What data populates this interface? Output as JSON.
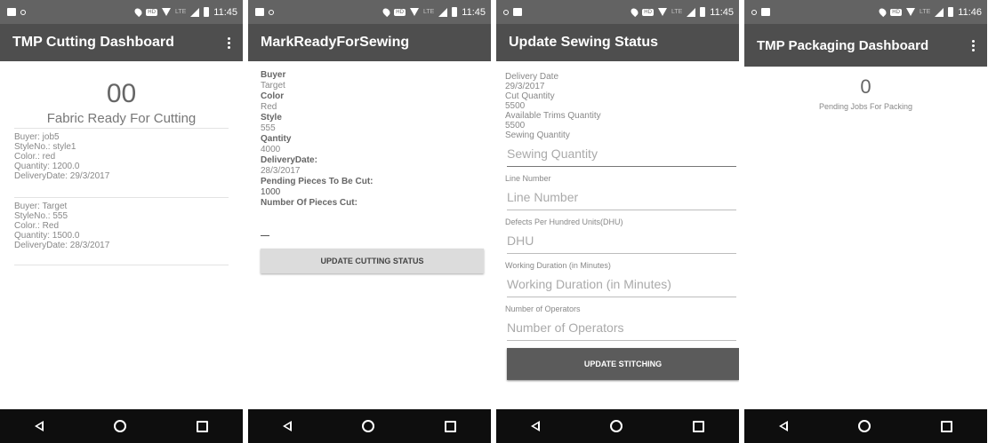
{
  "status_bar": {
    "time": "11:45",
    "time_last": "11:46"
  },
  "screens": {
    "cutting": {
      "title": "TMP Cutting Dashboard",
      "count": "00",
      "count_label": "Fabric Ready For Cutting",
      "jobs": [
        {
          "buyer": "Buyer: job5",
          "style": "StyleNo.: style1",
          "color": "Color.: red",
          "quantity": "Quantity: 1200.0",
          "delivery": "DeliveryDate: 29/3/2017"
        },
        {
          "buyer": "Buyer: Target",
          "style": "StyleNo.: 555",
          "color": "Color.: Red",
          "quantity": "Quantity: 1500.0",
          "delivery": "DeliveryDate: 28/3/2017"
        }
      ]
    },
    "mark_ready": {
      "title": "MarkReadyForSewing",
      "buyer_label": "Buyer",
      "buyer": "Target",
      "color_label": "Color",
      "color": "Red",
      "style_label": "Style",
      "style": "555",
      "qty_label": "Qantity",
      "qty": "4000",
      "delivery_label": "DeliveryDate:",
      "delivery": "28/3/2017",
      "pending_label": "Pending Pieces To Be Cut:",
      "pending": "1000",
      "cut_label": "Number Of Pieces Cut:",
      "button": "UPDATE CUTTING STATUS"
    },
    "sewing": {
      "title": "Update Sewing Status",
      "delivery_label": "Delivery Date",
      "delivery": "29/3/2017",
      "cut_label": "Cut Quantity",
      "cut": "5500",
      "trims_label": "Available Trims Quantity",
      "trims": "5500",
      "sewing_label": "Sewing Quantity",
      "sewing_placeholder": "Sewing Quantity",
      "line_label": "Line Number",
      "line_placeholder": "Line Number",
      "dhu_label": "Defects Per Hundred Units(DHU)",
      "dhu_placeholder": "DHU",
      "duration_label": "Working Duration (in Minutes)",
      "duration_placeholder": "Working Duration (in Minutes)",
      "operators_label": "Number of Operators",
      "operators_placeholder": "Number of Operators",
      "button": "UPDATE STITCHING"
    },
    "packaging": {
      "title": "TMP Packaging Dashboard",
      "count": "0",
      "count_label": "Pending Jobs For Packing"
    }
  },
  "icons": {
    "back": "nav-back-icon",
    "home": "nav-home-icon",
    "recent": "nav-recent-icon",
    "menu": "overflow-menu-icon"
  }
}
